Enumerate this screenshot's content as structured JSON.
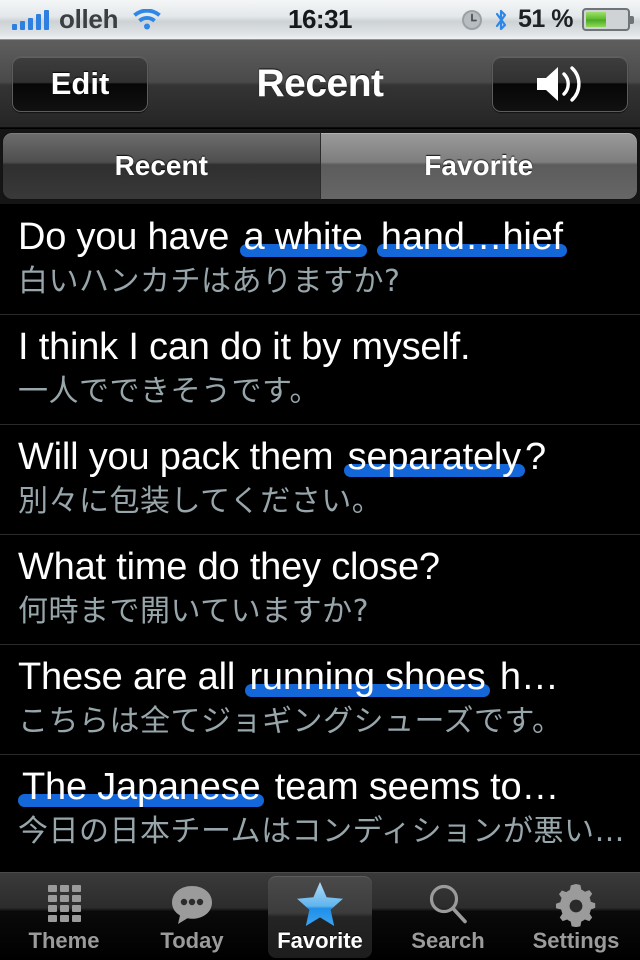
{
  "statusbar": {
    "carrier": "olleh",
    "wifi_icon": "wifi-icon",
    "time": "16:31",
    "alarm_icon": "alarm-clock-icon",
    "bluetooth_icon": "bluetooth-icon",
    "battery_percent": "51 %",
    "battery_level": 51,
    "signal_bars": 5
  },
  "navbar": {
    "edit_label": "Edit",
    "title": "Recent",
    "speaker_icon": "speaker-volume-icon"
  },
  "segmented": {
    "options": [
      {
        "label": "Recent",
        "selected": true
      },
      {
        "label": "Favorite",
        "selected": false
      }
    ]
  },
  "colors": {
    "highlight_blue": "#1467d8",
    "english_text": "#ffffff",
    "japanese_text": "#97a6ab",
    "accent_star": "#4aa8f0"
  },
  "list": {
    "rows": [
      {
        "segments": [
          {
            "text": "Do you have ",
            "highlight": false
          },
          {
            "text": "a white",
            "highlight": true
          },
          {
            "text": " ",
            "highlight": false
          },
          {
            "text": "hand…hief",
            "highlight": true
          }
        ],
        "english": "Do you have a white hand…hief",
        "japanese": "白いハンカチはありますか?"
      },
      {
        "segments": [
          {
            "text": "I think I can do it by myself.",
            "highlight": false
          }
        ],
        "english": "I think I can do it by myself.",
        "japanese": "一人でできそうです。"
      },
      {
        "segments": [
          {
            "text": "Will you pack them ",
            "highlight": false
          },
          {
            "text": "separately",
            "highlight": true
          },
          {
            "text": "?",
            "highlight": false
          }
        ],
        "english": "Will you pack them separately?",
        "japanese": "別々に包装してください。"
      },
      {
        "segments": [
          {
            "text": "What time do they close?",
            "highlight": false
          }
        ],
        "english": "What time do they close?",
        "japanese": "何時まで開いていますか?"
      },
      {
        "segments": [
          {
            "text": "These are all ",
            "highlight": false
          },
          {
            "text": "running shoes",
            "highlight": true
          },
          {
            "text": " h…",
            "highlight": false
          }
        ],
        "english": "These are all running shoes h…",
        "japanese": "こちらは全てジョギングシューズです。"
      },
      {
        "segments": [
          {
            "text": "The Japanese",
            "highlight": true
          },
          {
            "text": " team seems to…",
            "highlight": false
          }
        ],
        "english": "The Japanese team seems to…",
        "japanese": "今日の日本チームはコンディションが悪い…"
      }
    ]
  },
  "tabbar": {
    "tabs": [
      {
        "label": "Theme",
        "icon": "grid-icon",
        "selected": false
      },
      {
        "label": "Today",
        "icon": "speech-bubble-icon",
        "selected": false
      },
      {
        "label": "Favorite",
        "icon": "star-icon",
        "selected": true
      },
      {
        "label": "Search",
        "icon": "search-icon",
        "selected": false
      },
      {
        "label": "Settings",
        "icon": "gear-icon",
        "selected": false
      }
    ]
  }
}
